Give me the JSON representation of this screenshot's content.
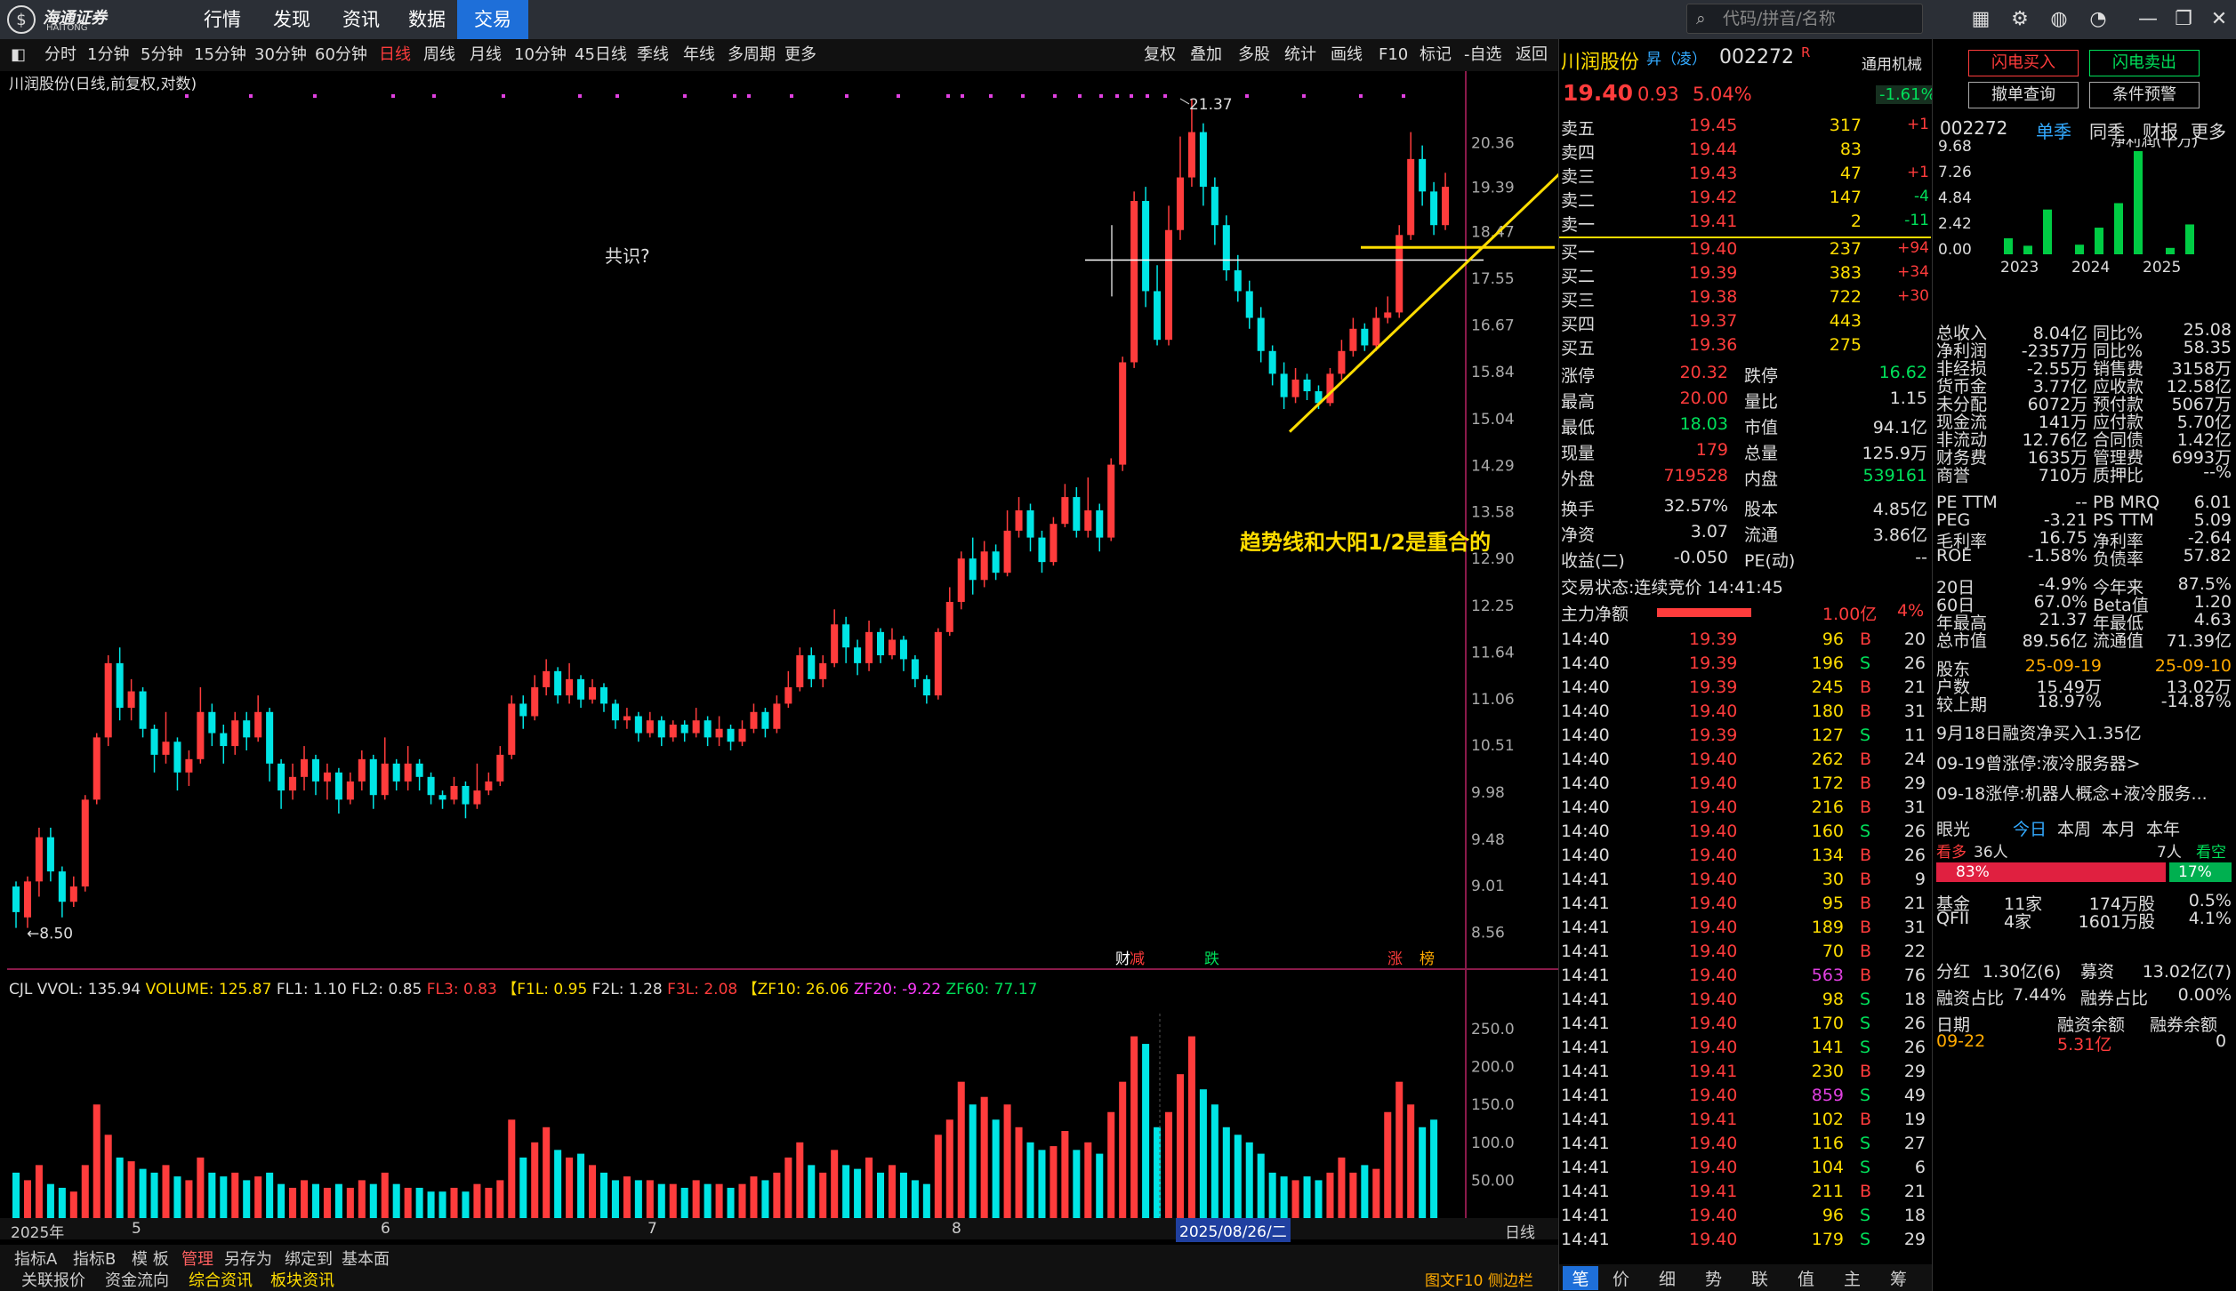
{
  "app": {
    "logo_text": "海通证券",
    "logo_sub": "HAITONG",
    "nav": [
      "行情",
      "发现",
      "资讯",
      "数据",
      "交易"
    ],
    "active_nav": "交易",
    "search_placeholder": "代码/拼音/名称"
  },
  "periods": [
    "分时",
    "1分钟",
    "5分钟",
    "15分钟",
    "30分钟",
    "60分钟",
    "日线",
    "周线",
    "月线",
    "10分钟",
    "45日线",
    "季线",
    "年线",
    "多周期",
    "更多"
  ],
  "active_period": "日线",
  "tools": [
    "复权",
    "叠加",
    "多股",
    "统计",
    "画线",
    "F10",
    "标记",
    "-自选",
    "返回"
  ],
  "chart_title": "川润股份(日线,前复权,对数)",
  "annot_question": "共识?",
  "annot_trend": "趋势线和大阳1/2是重合的",
  "high_label": "21.37",
  "low_label": "8.50",
  "yaxis": [
    "20.36",
    "19.39",
    "18.47",
    "17.55",
    "16.67",
    "15.84",
    "15.04",
    "14.29",
    "13.58",
    "12.90",
    "12.25",
    "11.64",
    "11.06",
    "10.51",
    "9.98",
    "9.48",
    "9.01",
    "8.56"
  ],
  "event_marks": [
    "财",
    "减",
    "跌",
    "涨",
    "榜"
  ],
  "vol_header": {
    "cjl": "CJL",
    "vvol": "VVOL: 135.94",
    "volume": "VOLUME: 125.87",
    "fl1": "FL1: 1.10",
    "fl2": "FL2: 0.85",
    "fl3": "FL3: 0.83",
    "f1l": "【F1L: 0.95",
    "f2l": "F2L: 1.28",
    "f3l": "F3L: 2.08",
    "zf10": "【ZF10: 26.06",
    "zf20": "ZF20: -9.22",
    "zf60": "ZF60: 77.17"
  },
  "vol_axis": [
    "250.0",
    "200.0",
    "150.0",
    "100.0",
    "50.00"
  ],
  "time_axis": [
    "2025年",
    "5",
    "6",
    "7",
    "8",
    "2025/08/26/二"
  ],
  "time_axis_right": "日线",
  "bottom_tabs": [
    "指标A",
    "指标B",
    "模 板",
    "管理",
    "另存为",
    "绑定到",
    "基本面"
  ],
  "bottom_tabs2": [
    "关联报价",
    "资金流向",
    "综合资讯",
    "板块资讯"
  ],
  "bottom_right": "图文F10 侧边栏",
  "chart_data": {
    "type": "candlestick",
    "title": "川润股份(日线,前复权,对数)",
    "ylim": [
      8.3,
      21.6
    ],
    "candles": [
      [
        9.0,
        8.75,
        9.05,
        8.6
      ],
      [
        8.7,
        9.05,
        9.1,
        8.6
      ],
      [
        9.05,
        9.5,
        9.6,
        8.9
      ],
      [
        9.5,
        9.15,
        9.6,
        9.05
      ],
      [
        9.15,
        8.85,
        9.2,
        8.7
      ],
      [
        8.85,
        9.0,
        9.1,
        8.8
      ],
      [
        9.0,
        9.9,
        9.95,
        8.95
      ],
      [
        9.9,
        10.6,
        10.65,
        9.85
      ],
      [
        10.6,
        11.5,
        11.6,
        10.5
      ],
      [
        11.5,
        10.95,
        11.7,
        10.8
      ],
      [
        10.95,
        11.15,
        11.3,
        10.8
      ],
      [
        11.15,
        10.7,
        11.2,
        10.6
      ],
      [
        10.7,
        10.4,
        10.75,
        10.2
      ],
      [
        10.4,
        10.55,
        10.9,
        10.3
      ],
      [
        10.55,
        10.2,
        10.6,
        10.0
      ],
      [
        10.2,
        10.35,
        10.45,
        10.05
      ],
      [
        10.35,
        10.9,
        11.2,
        10.3
      ],
      [
        10.9,
        10.65,
        11.0,
        10.5
      ],
      [
        10.65,
        10.5,
        10.75,
        10.3
      ],
      [
        10.5,
        10.8,
        10.9,
        10.4
      ],
      [
        10.8,
        10.6,
        10.9,
        10.45
      ],
      [
        10.6,
        10.9,
        11.1,
        10.55
      ],
      [
        10.9,
        10.3,
        10.95,
        10.1
      ],
      [
        10.3,
        10.0,
        10.35,
        9.8
      ],
      [
        10.0,
        10.15,
        10.3,
        9.9
      ],
      [
        10.15,
        10.35,
        10.5,
        10.0
      ],
      [
        10.35,
        10.1,
        10.4,
        9.95
      ],
      [
        10.1,
        10.2,
        10.3,
        9.9
      ],
      [
        10.2,
        9.9,
        10.25,
        9.75
      ],
      [
        9.9,
        10.1,
        10.2,
        9.85
      ],
      [
        10.1,
        10.35,
        10.45,
        10.0
      ],
      [
        10.35,
        9.95,
        10.4,
        9.8
      ],
      [
        9.95,
        10.3,
        10.6,
        9.9
      ],
      [
        10.3,
        10.1,
        10.35,
        10.0
      ],
      [
        10.1,
        10.3,
        10.5,
        10.0
      ],
      [
        10.3,
        10.15,
        10.35,
        10.0
      ],
      [
        10.15,
        9.95,
        10.2,
        9.85
      ],
      [
        9.95,
        9.9,
        10.0,
        9.8
      ],
      [
        9.9,
        10.05,
        10.15,
        9.85
      ],
      [
        10.05,
        9.85,
        10.1,
        9.7
      ],
      [
        9.85,
        10.0,
        10.3,
        9.8
      ],
      [
        10.0,
        10.1,
        10.2,
        9.95
      ],
      [
        10.1,
        10.4,
        10.5,
        10.05
      ],
      [
        10.4,
        11.0,
        11.1,
        10.35
      ],
      [
        11.0,
        10.85,
        11.1,
        10.7
      ],
      [
        10.85,
        11.2,
        11.35,
        10.8
      ],
      [
        11.2,
        11.4,
        11.55,
        11.1
      ],
      [
        11.4,
        11.1,
        11.45,
        11.0
      ],
      [
        11.1,
        11.3,
        11.5,
        11.0
      ],
      [
        11.3,
        11.05,
        11.35,
        10.95
      ],
      [
        11.05,
        11.2,
        11.3,
        11.0
      ],
      [
        11.2,
        11.0,
        11.25,
        10.9
      ],
      [
        11.0,
        10.8,
        11.05,
        10.7
      ],
      [
        10.8,
        10.85,
        10.95,
        10.7
      ],
      [
        10.85,
        10.65,
        10.9,
        10.55
      ],
      [
        10.65,
        10.8,
        10.9,
        10.6
      ],
      [
        10.8,
        10.6,
        10.85,
        10.5
      ],
      [
        10.6,
        10.75,
        10.8,
        10.55
      ],
      [
        10.75,
        10.65,
        10.8,
        10.55
      ],
      [
        10.65,
        10.8,
        10.95,
        10.6
      ],
      [
        10.8,
        10.6,
        10.85,
        10.5
      ],
      [
        10.6,
        10.7,
        10.85,
        10.5
      ],
      [
        10.7,
        10.55,
        10.75,
        10.45
      ],
      [
        10.55,
        10.7,
        10.8,
        10.5
      ],
      [
        10.7,
        10.9,
        11.0,
        10.65
      ],
      [
        10.9,
        10.7,
        10.95,
        10.6
      ],
      [
        10.7,
        11.0,
        11.1,
        10.65
      ],
      [
        11.0,
        11.2,
        11.4,
        10.95
      ],
      [
        11.2,
        11.6,
        11.7,
        11.15
      ],
      [
        11.6,
        11.3,
        11.7,
        11.2
      ],
      [
        11.3,
        11.5,
        11.6,
        11.2
      ],
      [
        11.5,
        12.0,
        12.2,
        11.45
      ],
      [
        12.0,
        11.7,
        12.1,
        11.5
      ],
      [
        11.7,
        11.5,
        11.8,
        11.35
      ],
      [
        11.5,
        11.9,
        12.05,
        11.4
      ],
      [
        11.9,
        11.6,
        11.95,
        11.5
      ],
      [
        11.6,
        11.8,
        11.95,
        11.55
      ],
      [
        11.8,
        11.55,
        11.85,
        11.4
      ],
      [
        11.55,
        11.3,
        11.6,
        11.2
      ],
      [
        11.3,
        11.1,
        11.35,
        11.0
      ],
      [
        11.1,
        11.9,
        11.95,
        11.05
      ],
      [
        11.9,
        12.3,
        12.5,
        11.85
      ],
      [
        12.3,
        12.9,
        13.0,
        12.2
      ],
      [
        12.9,
        12.6,
        13.2,
        12.4
      ],
      [
        12.6,
        13.0,
        13.15,
        12.5
      ],
      [
        13.0,
        12.7,
        13.1,
        12.6
      ],
      [
        12.7,
        13.3,
        13.6,
        12.65
      ],
      [
        13.3,
        13.6,
        13.8,
        13.2
      ],
      [
        13.6,
        13.2,
        13.7,
        13.0
      ],
      [
        13.2,
        12.85,
        13.3,
        12.7
      ],
      [
        12.85,
        13.4,
        13.5,
        12.8
      ],
      [
        13.4,
        13.8,
        14.0,
        13.35
      ],
      [
        13.8,
        13.3,
        13.95,
        13.2
      ],
      [
        13.3,
        13.6,
        14.1,
        13.2
      ],
      [
        13.6,
        13.2,
        13.7,
        13.0
      ],
      [
        13.2,
        14.3,
        14.4,
        13.15
      ],
      [
        14.3,
        16.0,
        16.1,
        14.2
      ],
      [
        16.0,
        19.1,
        19.3,
        15.9
      ],
      [
        19.1,
        17.3,
        19.4,
        17.0
      ],
      [
        17.3,
        16.4,
        17.8,
        16.3
      ],
      [
        16.4,
        18.5,
        19.0,
        16.3
      ],
      [
        18.5,
        19.6,
        20.5,
        18.3
      ],
      [
        19.6,
        20.6,
        21.37,
        19.4
      ],
      [
        20.6,
        19.4,
        20.8,
        19.0
      ],
      [
        19.4,
        18.6,
        19.6,
        18.2
      ],
      [
        18.6,
        17.7,
        18.8,
        17.5
      ],
      [
        17.7,
        17.3,
        18.0,
        17.1
      ],
      [
        17.3,
        16.8,
        17.5,
        16.6
      ],
      [
        16.8,
        16.2,
        17.0,
        16.0
      ],
      [
        16.2,
        15.8,
        16.3,
        15.6
      ],
      [
        15.8,
        15.4,
        16.0,
        15.2
      ],
      [
        15.4,
        15.7,
        15.9,
        15.3
      ],
      [
        15.7,
        15.5,
        15.8,
        15.35
      ],
      [
        15.5,
        15.3,
        15.6,
        15.2
      ],
      [
        15.3,
        15.8,
        15.9,
        15.25
      ],
      [
        15.8,
        16.2,
        16.4,
        15.7
      ],
      [
        16.2,
        16.6,
        16.8,
        16.1
      ],
      [
        16.6,
        16.3,
        16.7,
        16.2
      ],
      [
        16.3,
        16.8,
        17.0,
        16.2
      ],
      [
        16.8,
        16.9,
        17.2,
        16.7
      ],
      [
        16.9,
        18.4,
        18.6,
        16.8
      ],
      [
        18.4,
        20.0,
        20.6,
        18.3
      ],
      [
        20.0,
        19.3,
        20.3,
        19.0
      ],
      [
        19.3,
        18.6,
        19.5,
        18.4
      ],
      [
        18.6,
        19.4,
        19.7,
        18.5
      ]
    ],
    "volumes": [
      60,
      50,
      70,
      45,
      40,
      35,
      70,
      150,
      110,
      80,
      75,
      65,
      60,
      70,
      55,
      50,
      80,
      60,
      55,
      60,
      50,
      55,
      60,
      45,
      40,
      50,
      45,
      40,
      45,
      40,
      50,
      45,
      60,
      45,
      40,
      40,
      35,
      35,
      40,
      35,
      45,
      40,
      50,
      130,
      80,
      100,
      120,
      90,
      80,
      85,
      70,
      60,
      50,
      55,
      50,
      50,
      45,
      45,
      40,
      50,
      45,
      45,
      40,
      45,
      55,
      50,
      60,
      80,
      100,
      70,
      60,
      90,
      70,
      65,
      80,
      60,
      70,
      60,
      50,
      45,
      110,
      130,
      180,
      150,
      160,
      130,
      150,
      120,
      100,
      90,
      95,
      115,
      90,
      100,
      85,
      140,
      180,
      240,
      230,
      120,
      140,
      190,
      240,
      170,
      150,
      120,
      110,
      100,
      85,
      60,
      55,
      50,
      55,
      50,
      60,
      80,
      60,
      70,
      65,
      140,
      180,
      150,
      120,
      130
    ],
    "annotations": [
      "21.37",
      "8.50",
      "共识?",
      "趋势线和大阳1/2是重合的"
    ]
  },
  "quote": {
    "name": "川润股份",
    "code": "002272",
    "tag": "昇（凌）",
    "r": "R",
    "source": "通用机械",
    "price": "19.40",
    "chg": "0.93",
    "pct": "5.04%",
    "sector_pct": "-1.61%",
    "buttons": [
      "闪电买入",
      "闪电卖出",
      "撤单查询",
      "条件预警"
    ],
    "asks": [
      {
        "l": "卖五",
        "p": "19.45",
        "v": "317",
        "d": "+1"
      },
      {
        "l": "卖四",
        "p": "19.44",
        "v": "83",
        "d": ""
      },
      {
        "l": "卖三",
        "p": "19.43",
        "v": "47",
        "d": "+1"
      },
      {
        "l": "卖二",
        "p": "19.42",
        "v": "147",
        "d": "-4"
      },
      {
        "l": "卖一",
        "p": "19.41",
        "v": "2",
        "d": "-11"
      }
    ],
    "bids": [
      {
        "l": "买一",
        "p": "19.40",
        "v": "237",
        "d": "+94"
      },
      {
        "l": "买二",
        "p": "19.39",
        "v": "383",
        "d": "+34"
      },
      {
        "l": "买三",
        "p": "19.38",
        "v": "722",
        "d": "+30"
      },
      {
        "l": "买四",
        "p": "19.37",
        "v": "443",
        "d": ""
      },
      {
        "l": "买五",
        "p": "19.36",
        "v": "275",
        "d": ""
      }
    ],
    "stats": [
      [
        "涨停",
        "20.32",
        "跌停",
        "16.62"
      ],
      [
        "最高",
        "20.00",
        "量比",
        "1.15"
      ],
      [
        "最低",
        "18.03",
        "市值",
        "94.1亿"
      ],
      [
        "现量",
        "179",
        "总量",
        "125.9万"
      ],
      [
        "外盘",
        "719528",
        "内盘",
        "539161"
      ]
    ],
    "stats2": [
      [
        "换手",
        "32.57%",
        "股本",
        "4.85亿"
      ],
      [
        "净资",
        "3.07",
        "流通",
        "3.86亿"
      ],
      [
        "收益(二)",
        "-0.050",
        "PE(动)",
        "--"
      ]
    ],
    "status_label": "交易状态:",
    "status_value": "连续竞价 14:41:45",
    "mainflow_label": "主力净额",
    "mainflow_value": "1.00亿",
    "mainflow_pct": "4%",
    "ticks": [
      [
        "14:40",
        "19.39",
        "96",
        "B",
        "20"
      ],
      [
        "14:40",
        "19.39",
        "196",
        "S",
        "26"
      ],
      [
        "14:40",
        "19.39",
        "245",
        "B",
        "21"
      ],
      [
        "14:40",
        "19.40",
        "180",
        "B",
        "31"
      ],
      [
        "14:40",
        "19.39",
        "127",
        "S",
        "11"
      ],
      [
        "14:40",
        "19.40",
        "262",
        "B",
        "24"
      ],
      [
        "14:40",
        "19.40",
        "172",
        "B",
        "29"
      ],
      [
        "14:40",
        "19.40",
        "216",
        "B",
        "31"
      ],
      [
        "14:40",
        "19.40",
        "160",
        "S",
        "26"
      ],
      [
        "14:40",
        "19.40",
        "134",
        "B",
        "26"
      ],
      [
        "14:41",
        "19.40",
        "30",
        "B",
        "9"
      ],
      [
        "14:41",
        "19.40",
        "95",
        "B",
        "21"
      ],
      [
        "14:41",
        "19.40",
        "189",
        "B",
        "31"
      ],
      [
        "14:41",
        "19.40",
        "70",
        "B",
        "22"
      ],
      [
        "14:41",
        "19.40",
        "563",
        "B",
        "76"
      ],
      [
        "14:41",
        "19.40",
        "98",
        "S",
        "18"
      ],
      [
        "14:41",
        "19.40",
        "170",
        "S",
        "26"
      ],
      [
        "14:41",
        "19.40",
        "141",
        "S",
        "26"
      ],
      [
        "14:41",
        "19.41",
        "230",
        "B",
        "29"
      ],
      [
        "14:41",
        "19.40",
        "859",
        "S",
        "49"
      ],
      [
        "14:41",
        "19.41",
        "102",
        "B",
        "19"
      ],
      [
        "14:41",
        "19.40",
        "116",
        "S",
        "27"
      ],
      [
        "14:41",
        "19.40",
        "104",
        "S",
        "6"
      ],
      [
        "14:41",
        "19.41",
        "211",
        "B",
        "21"
      ],
      [
        "14:41",
        "19.40",
        "96",
        "S",
        "18"
      ],
      [
        "14:41",
        "19.40",
        "179",
        "S",
        "29"
      ]
    ]
  },
  "tick_tabs": [
    "笔",
    "价",
    "细",
    "势",
    "联",
    "值",
    "主",
    "筹"
  ],
  "fund": {
    "code": "002272",
    "tabs": [
      "单季",
      "同季",
      "财报",
      "更多"
    ],
    "chart_title": "净利润(千万)",
    "yaxis": [
      "9.68",
      "7.26",
      "4.84",
      "2.42",
      "0.00"
    ],
    "years": [
      "2023",
      "2024",
      "2025"
    ],
    "bars": [
      1.5,
      0.8,
      4.2,
      0.9,
      2.5,
      4.8,
      9.68,
      0.6,
      2.8
    ],
    "rows": [
      [
        "总收入",
        "8.04亿",
        "同比%",
        "25.08"
      ],
      [
        "净利润",
        "-2357万",
        "同比%",
        "58.35"
      ],
      [
        "非经损",
        "-2.55万",
        "销售费",
        "3158万"
      ],
      [
        "货币金",
        "3.77亿",
        "应收款",
        "12.58亿"
      ],
      [
        "未分配",
        "6072万",
        "预付款",
        "5067万"
      ],
      [
        "现金流",
        "141万",
        "应付款",
        "5.70亿"
      ],
      [
        "非流动",
        "12.76亿",
        "合同债",
        "1.42亿"
      ],
      [
        "财务费",
        "1635万",
        "管理费",
        "6993万"
      ],
      [
        "商誉",
        "710万",
        "质押比",
        "--%"
      ]
    ],
    "rows2": [
      [
        "PE TTM",
        "--",
        "PB MRQ",
        "6.01"
      ],
      [
        "PEG",
        "-3.21",
        "PS TTM",
        "5.09"
      ],
      [
        "毛利率",
        "16.75",
        "净利率",
        "-2.64"
      ],
      [
        "ROE",
        "-1.58%",
        "负债率",
        "57.82"
      ]
    ],
    "rows3": [
      [
        "20日",
        "-4.9%",
        "今年来",
        "87.5%"
      ],
      [
        "60日",
        "67.0%",
        "Beta值",
        "1.20"
      ],
      [
        "年最高",
        "21.37",
        "年最低",
        "4.63"
      ],
      [
        "总市值",
        "89.56亿",
        "流通值",
        "71.39亿"
      ]
    ],
    "holders": [
      [
        "股东",
        "25-09-19",
        "25-09-10"
      ],
      [
        "户数",
        "15.49万",
        "13.02万"
      ],
      [
        "较上期",
        "18.97%",
        "-14.87%"
      ]
    ],
    "news": [
      "9月18日融资净买入1.35亿",
      "09-19曾涨停:液冷服务器>",
      "09-18涨停:机器人概念+液冷服务..."
    ],
    "eye_label": "眼光",
    "eye_tabs": [
      "今日",
      "本周",
      "本月",
      "本年"
    ],
    "bull": "看多",
    "bull_n": "36人",
    "bear_n": "7人",
    "bear": "看空",
    "bull_pct": "83%",
    "bear_pct": "17%",
    "inst": [
      [
        "基金",
        "11家",
        "174万股",
        "0.5%"
      ],
      [
        "QFII",
        "4家",
        "1601万股",
        "4.1%"
      ]
    ],
    "div": [
      "分红",
      "1.30亿(6)",
      "募资",
      "13.02亿(7)"
    ],
    "margin": [
      "融资占比",
      "7.44%",
      "融券占比",
      "0.00%"
    ],
    "margin_hdr": [
      "日期",
      "融资余额",
      "融券余额"
    ],
    "margin_row": [
      "09-22",
      "5.31亿",
      "0"
    ]
  },
  "colors": {
    "up": "#ff3c3c",
    "down": "#00e5e5",
    "accent": "#1e6fd9"
  }
}
